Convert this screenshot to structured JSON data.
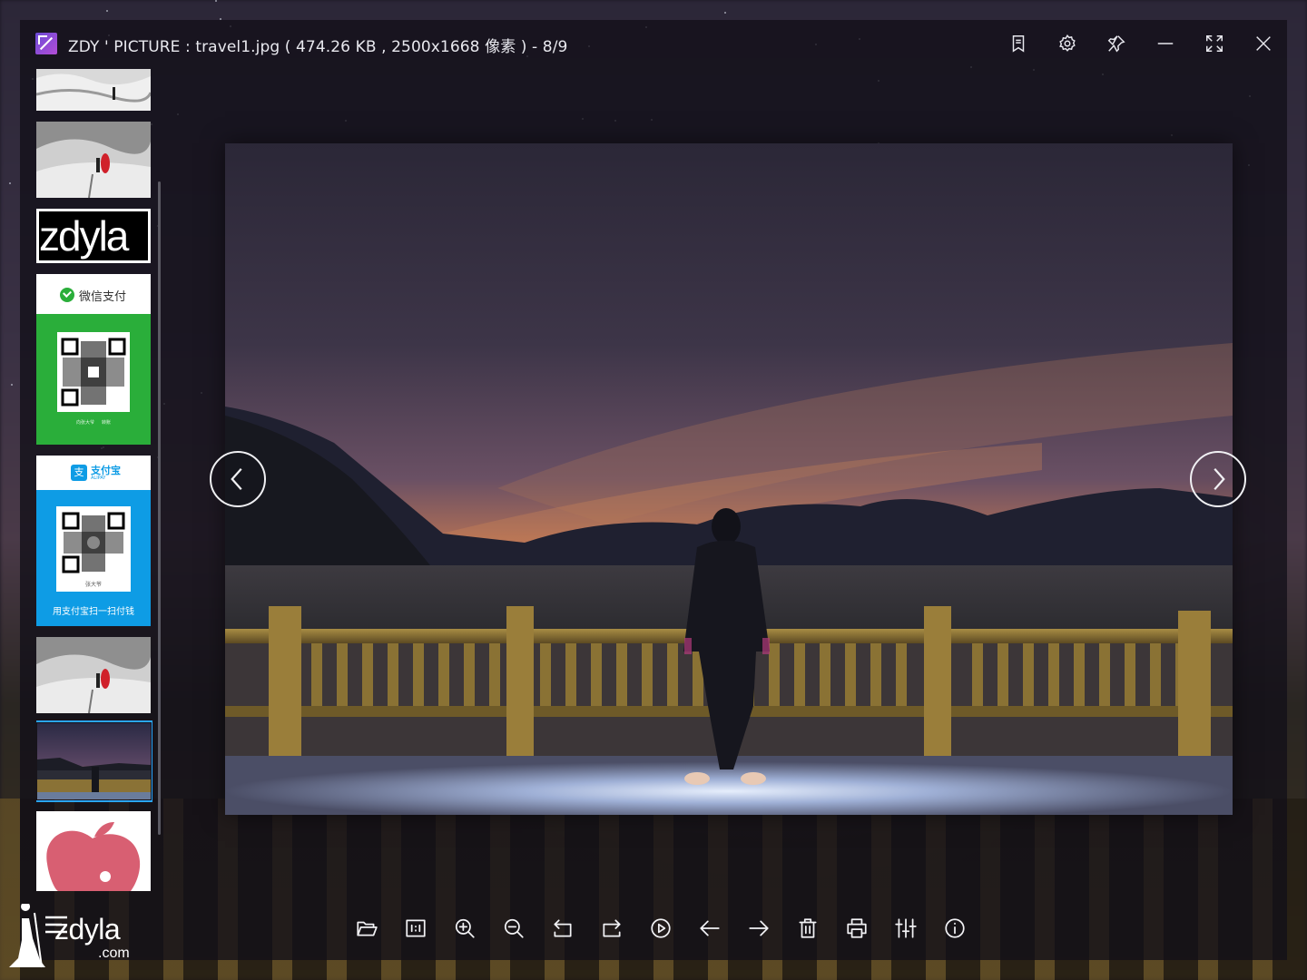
{
  "window": {
    "title": "ZDY ' PICTURE : travel1.jpg ( 474.26 KB , 2500x1668 像素 ) - 8/9",
    "accent_color": "#2aa6ff"
  },
  "titlebar_buttons": [
    {
      "name": "bookmark-icon"
    },
    {
      "name": "gear-icon"
    },
    {
      "name": "pin-icon"
    },
    {
      "name": "minimize-icon"
    },
    {
      "name": "fullscreen-icon"
    },
    {
      "name": "close-icon"
    }
  ],
  "thumbnails": {
    "wechat_label": "微信支付",
    "wechat_caption": "向张大爷     转账",
    "alipay_label": "支付宝",
    "alipay_sub": "ALIPAY",
    "alipay_name": "张大爷",
    "alipay_caption": "用支付宝扫一扫付钱",
    "text_logo": "zdyla",
    "selected_index": 7
  },
  "toolbar": [
    {
      "name": "open-folder-icon"
    },
    {
      "name": "actual-size-icon"
    },
    {
      "name": "zoom-in-icon"
    },
    {
      "name": "zoom-out-icon"
    },
    {
      "name": "rotate-left-icon"
    },
    {
      "name": "rotate-right-icon"
    },
    {
      "name": "slideshow-play-icon"
    },
    {
      "name": "previous-arrow-icon"
    },
    {
      "name": "next-arrow-icon"
    },
    {
      "name": "delete-icon"
    },
    {
      "name": "print-icon"
    },
    {
      "name": "adjust-sliders-icon"
    },
    {
      "name": "info-icon"
    }
  ],
  "watermark": {
    "brand": "zdyla",
    "domain": ".com"
  }
}
